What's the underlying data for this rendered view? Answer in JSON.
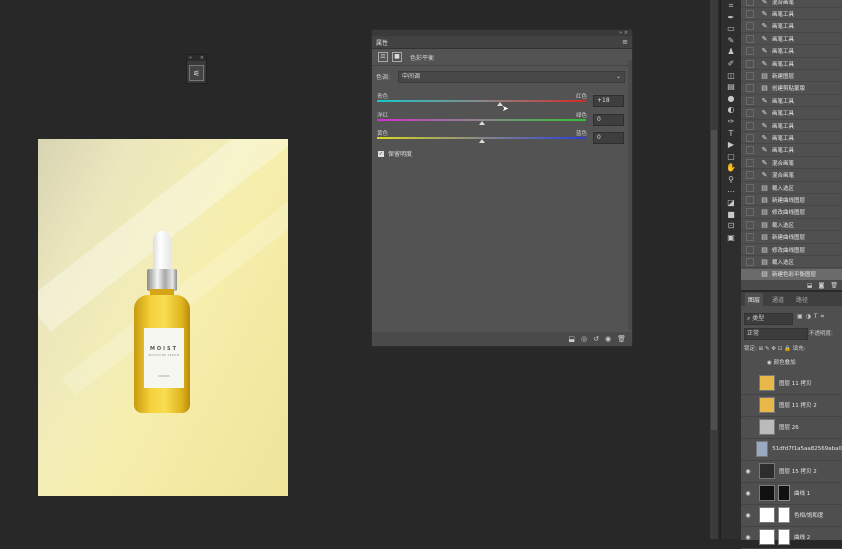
{
  "properties_panel": {
    "tab_label": "属性",
    "adjustment_name": "色彩平衡",
    "tone_label": "色调:",
    "tone_value": "中间调",
    "sliders": [
      {
        "left": "青色",
        "right": "红色",
        "value": "+18",
        "position": 0.59
      },
      {
        "left": "洋红",
        "right": "绿色",
        "value": "0",
        "position": 0.5
      },
      {
        "left": "黄色",
        "right": "蓝色",
        "value": "0",
        "position": 0.5
      }
    ],
    "preserve_label": "保留明度",
    "preserve_checked": true
  },
  "bottle": {
    "brand": "MOIST",
    "subtitle": "MOISTURE SERUM",
    "bottom_text": "COSMOS"
  },
  "history_panel": {
    "items": [
      "混合画笔",
      "画笔工具",
      "画笔工具",
      "画笔工具",
      "画笔工具",
      "画笔工具",
      "新建图层",
      "创建剪贴蒙版",
      "画笔工具",
      "画笔工具",
      "画笔工具",
      "画笔工具",
      "画笔工具",
      "混合画笔",
      "混合画笔",
      "载入选区",
      "新建曲线图层",
      "修改曲线图层",
      "载入选区",
      "新建曲线图层",
      "修改曲线图层",
      "载入选区",
      "新建色彩平衡图层"
    ],
    "selected_index": 22
  },
  "layers_panel": {
    "tabs": [
      "图层",
      "通道",
      "路径"
    ],
    "filter_value": "类型",
    "blend_mode": "正常",
    "opacity_label": "不透明度:",
    "lock_label": "锁定:",
    "fill_label": "填充:",
    "effect_text": "颜色叠加",
    "layers": [
      {
        "name": "图层 11 拷贝",
        "visible": false
      },
      {
        "name": "图层 11 拷贝 2",
        "visible": false
      },
      {
        "name": "图层 26",
        "visible": false
      },
      {
        "name": "51dfd7f1a5aa82569aba0",
        "visible": false
      },
      {
        "name": "图层 15 拷贝 2",
        "visible": true
      },
      {
        "name": "曲线 1",
        "visible": true
      },
      {
        "name": "色相/饱和度",
        "visible": true
      },
      {
        "name": "曲线 2",
        "visible": true
      }
    ]
  }
}
